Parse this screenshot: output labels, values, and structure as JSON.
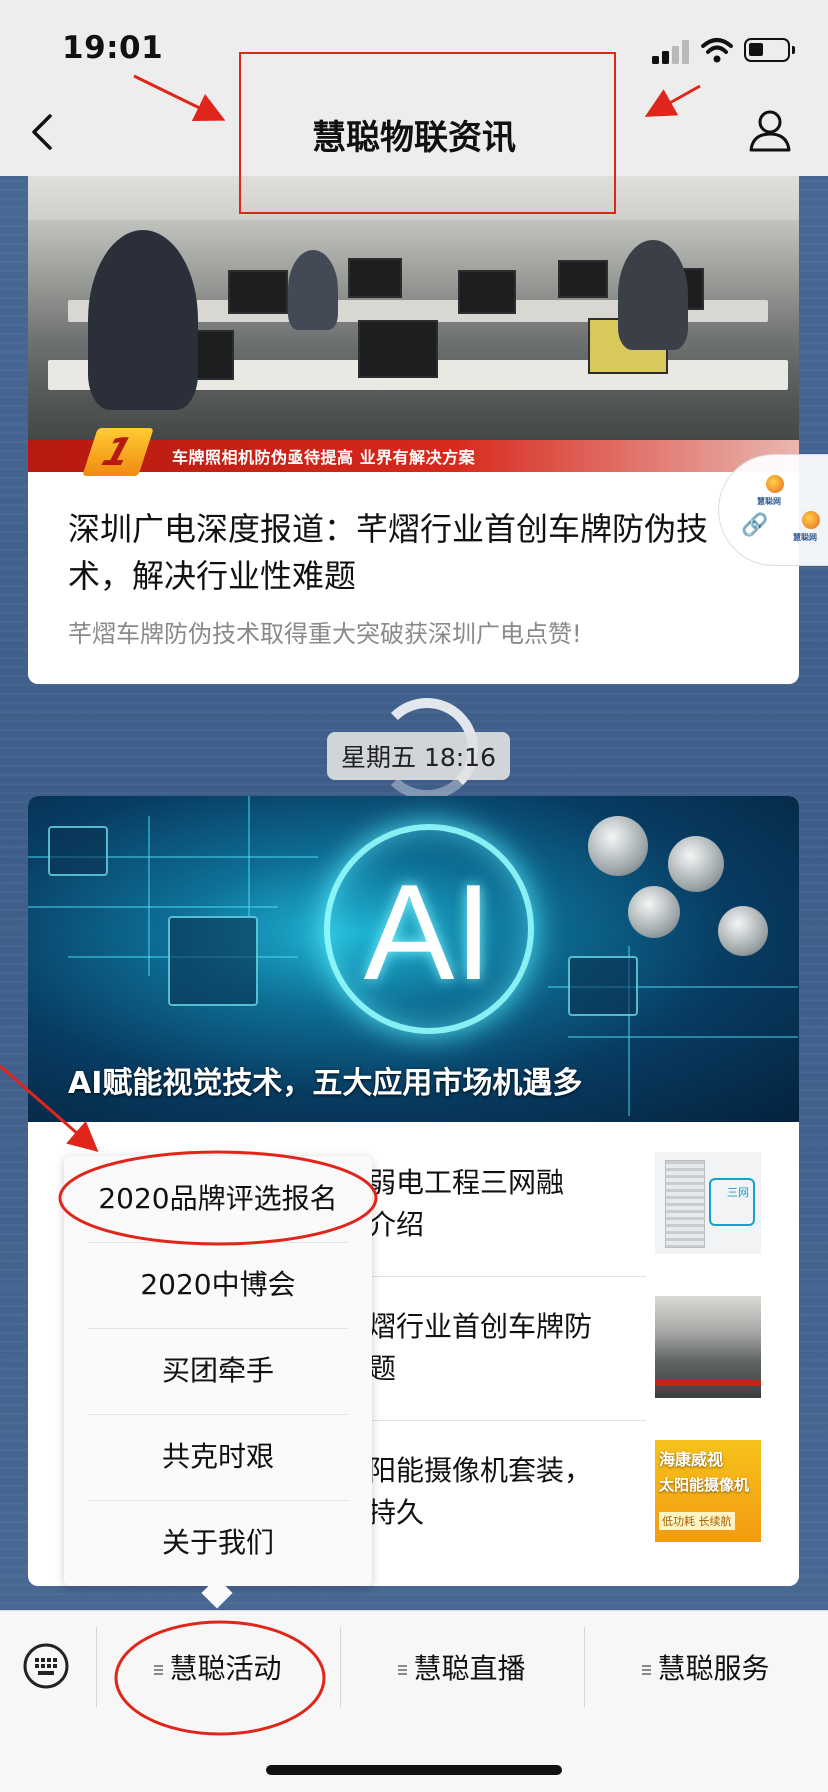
{
  "status_bar": {
    "time": "19:01"
  },
  "nav": {
    "title": "慧聪物联资讯"
  },
  "card1": {
    "image_ribbon_number": "1",
    "image_ribbon_text": "车牌照相机防伪亟待提高 业界有解决方案",
    "title": "深圳广电深度报道：芊熠行业首创车牌防伪技术，解决行业性难题",
    "description": "芊熠车牌防伪技术取得重大突破获深圳广电点赞!"
  },
  "float_widget": {
    "logo_text": "慧聪网",
    "logo_text_2": "慧聪网"
  },
  "timestamp": "星期五 18:16",
  "card2": {
    "banner_big_text": "AI",
    "banner_caption": "AI赋能视觉技术，五大应用市场机遇多",
    "articles": [
      {
        "title_line1": "弱电工程三网融",
        "title_line2": "介绍",
        "thumb_label": "三网"
      },
      {
        "title_line1": "熠行业首创车牌防",
        "title_line2": "题"
      },
      {
        "title_line1": "阳能摄像机套装，",
        "title_line2": "持久",
        "thumb_label": "海康威视",
        "thumb_label_2": "太阳能摄像机",
        "thumb_tag": "低功耗 长续航"
      }
    ]
  },
  "popup_menu": {
    "items": [
      "2020品牌评选报名",
      "2020中博会",
      "买团牵手",
      "共克时艰",
      "关于我们"
    ]
  },
  "bottom_menu": {
    "items": [
      "慧聪活动",
      "慧聪直播",
      "慧聪服务"
    ]
  },
  "annotation_color": "#e0261b"
}
